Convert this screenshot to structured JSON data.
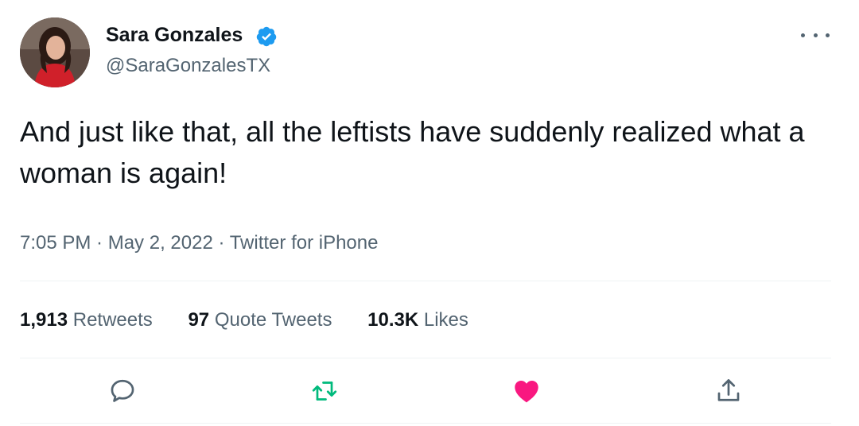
{
  "author": {
    "name": "Sara Gonzales",
    "handle": "@SaraGonzalesTX",
    "verified": true
  },
  "tweet": {
    "text": "And just like that, all the leftists have suddenly realized what a woman is again!",
    "time": "7:05 PM",
    "date": "May 2, 2022",
    "source": "Twitter for iPhone",
    "separator": " · "
  },
  "stats": {
    "retweets": {
      "count": "1,913",
      "label": "Retweets"
    },
    "quotes": {
      "count": "97",
      "label": "Quote Tweets"
    },
    "likes": {
      "count": "10.3K",
      "label": "Likes"
    }
  },
  "icons": {
    "more": "more-icon",
    "verified": "verified-badge-icon",
    "reply": "reply-icon",
    "retweet": "retweet-icon",
    "like": "heart-icon",
    "share": "share-icon"
  },
  "colors": {
    "verified": "#1d9bf0",
    "retweet": "#00ba7c",
    "like": "#f91880",
    "secondary_text": "#536471",
    "primary_text": "#0f1419"
  }
}
